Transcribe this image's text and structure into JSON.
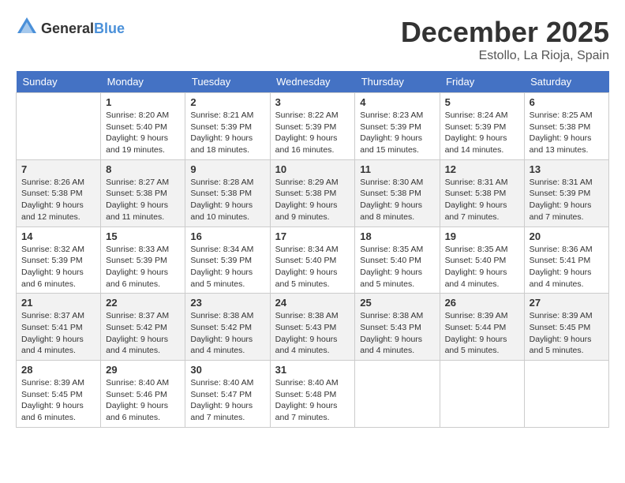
{
  "logo": {
    "general": "General",
    "blue": "Blue"
  },
  "title": "December 2025",
  "location": "Estollo, La Rioja, Spain",
  "weekdays": [
    "Sunday",
    "Monday",
    "Tuesday",
    "Wednesday",
    "Thursday",
    "Friday",
    "Saturday"
  ],
  "weeks": [
    [
      {
        "day": "",
        "sunrise": "",
        "sunset": "",
        "daylight": ""
      },
      {
        "day": "1",
        "sunrise": "Sunrise: 8:20 AM",
        "sunset": "Sunset: 5:40 PM",
        "daylight": "Daylight: 9 hours and 19 minutes."
      },
      {
        "day": "2",
        "sunrise": "Sunrise: 8:21 AM",
        "sunset": "Sunset: 5:39 PM",
        "daylight": "Daylight: 9 hours and 18 minutes."
      },
      {
        "day": "3",
        "sunrise": "Sunrise: 8:22 AM",
        "sunset": "Sunset: 5:39 PM",
        "daylight": "Daylight: 9 hours and 16 minutes."
      },
      {
        "day": "4",
        "sunrise": "Sunrise: 8:23 AM",
        "sunset": "Sunset: 5:39 PM",
        "daylight": "Daylight: 9 hours and 15 minutes."
      },
      {
        "day": "5",
        "sunrise": "Sunrise: 8:24 AM",
        "sunset": "Sunset: 5:39 PM",
        "daylight": "Daylight: 9 hours and 14 minutes."
      },
      {
        "day": "6",
        "sunrise": "Sunrise: 8:25 AM",
        "sunset": "Sunset: 5:38 PM",
        "daylight": "Daylight: 9 hours and 13 minutes."
      }
    ],
    [
      {
        "day": "7",
        "sunrise": "Sunrise: 8:26 AM",
        "sunset": "Sunset: 5:38 PM",
        "daylight": "Daylight: 9 hours and 12 minutes."
      },
      {
        "day": "8",
        "sunrise": "Sunrise: 8:27 AM",
        "sunset": "Sunset: 5:38 PM",
        "daylight": "Daylight: 9 hours and 11 minutes."
      },
      {
        "day": "9",
        "sunrise": "Sunrise: 8:28 AM",
        "sunset": "Sunset: 5:38 PM",
        "daylight": "Daylight: 9 hours and 10 minutes."
      },
      {
        "day": "10",
        "sunrise": "Sunrise: 8:29 AM",
        "sunset": "Sunset: 5:38 PM",
        "daylight": "Daylight: 9 hours and 9 minutes."
      },
      {
        "day": "11",
        "sunrise": "Sunrise: 8:30 AM",
        "sunset": "Sunset: 5:38 PM",
        "daylight": "Daylight: 9 hours and 8 minutes."
      },
      {
        "day": "12",
        "sunrise": "Sunrise: 8:31 AM",
        "sunset": "Sunset: 5:38 PM",
        "daylight": "Daylight: 9 hours and 7 minutes."
      },
      {
        "day": "13",
        "sunrise": "Sunrise: 8:31 AM",
        "sunset": "Sunset: 5:39 PM",
        "daylight": "Daylight: 9 hours and 7 minutes."
      }
    ],
    [
      {
        "day": "14",
        "sunrise": "Sunrise: 8:32 AM",
        "sunset": "Sunset: 5:39 PM",
        "daylight": "Daylight: 9 hours and 6 minutes."
      },
      {
        "day": "15",
        "sunrise": "Sunrise: 8:33 AM",
        "sunset": "Sunset: 5:39 PM",
        "daylight": "Daylight: 9 hours and 6 minutes."
      },
      {
        "day": "16",
        "sunrise": "Sunrise: 8:34 AM",
        "sunset": "Sunset: 5:39 PM",
        "daylight": "Daylight: 9 hours and 5 minutes."
      },
      {
        "day": "17",
        "sunrise": "Sunrise: 8:34 AM",
        "sunset": "Sunset: 5:40 PM",
        "daylight": "Daylight: 9 hours and 5 minutes."
      },
      {
        "day": "18",
        "sunrise": "Sunrise: 8:35 AM",
        "sunset": "Sunset: 5:40 PM",
        "daylight": "Daylight: 9 hours and 5 minutes."
      },
      {
        "day": "19",
        "sunrise": "Sunrise: 8:35 AM",
        "sunset": "Sunset: 5:40 PM",
        "daylight": "Daylight: 9 hours and 4 minutes."
      },
      {
        "day": "20",
        "sunrise": "Sunrise: 8:36 AM",
        "sunset": "Sunset: 5:41 PM",
        "daylight": "Daylight: 9 hours and 4 minutes."
      }
    ],
    [
      {
        "day": "21",
        "sunrise": "Sunrise: 8:37 AM",
        "sunset": "Sunset: 5:41 PM",
        "daylight": "Daylight: 9 hours and 4 minutes."
      },
      {
        "day": "22",
        "sunrise": "Sunrise: 8:37 AM",
        "sunset": "Sunset: 5:42 PM",
        "daylight": "Daylight: 9 hours and 4 minutes."
      },
      {
        "day": "23",
        "sunrise": "Sunrise: 8:38 AM",
        "sunset": "Sunset: 5:42 PM",
        "daylight": "Daylight: 9 hours and 4 minutes."
      },
      {
        "day": "24",
        "sunrise": "Sunrise: 8:38 AM",
        "sunset": "Sunset: 5:43 PM",
        "daylight": "Daylight: 9 hours and 4 minutes."
      },
      {
        "day": "25",
        "sunrise": "Sunrise: 8:38 AM",
        "sunset": "Sunset: 5:43 PM",
        "daylight": "Daylight: 9 hours and 4 minutes."
      },
      {
        "day": "26",
        "sunrise": "Sunrise: 8:39 AM",
        "sunset": "Sunset: 5:44 PM",
        "daylight": "Daylight: 9 hours and 5 minutes."
      },
      {
        "day": "27",
        "sunrise": "Sunrise: 8:39 AM",
        "sunset": "Sunset: 5:45 PM",
        "daylight": "Daylight: 9 hours and 5 minutes."
      }
    ],
    [
      {
        "day": "28",
        "sunrise": "Sunrise: 8:39 AM",
        "sunset": "Sunset: 5:45 PM",
        "daylight": "Daylight: 9 hours and 6 minutes."
      },
      {
        "day": "29",
        "sunrise": "Sunrise: 8:40 AM",
        "sunset": "Sunset: 5:46 PM",
        "daylight": "Daylight: 9 hours and 6 minutes."
      },
      {
        "day": "30",
        "sunrise": "Sunrise: 8:40 AM",
        "sunset": "Sunset: 5:47 PM",
        "daylight": "Daylight: 9 hours and 7 minutes."
      },
      {
        "day": "31",
        "sunrise": "Sunrise: 8:40 AM",
        "sunset": "Sunset: 5:48 PM",
        "daylight": "Daylight: 9 hours and 7 minutes."
      },
      {
        "day": "",
        "sunrise": "",
        "sunset": "",
        "daylight": ""
      },
      {
        "day": "",
        "sunrise": "",
        "sunset": "",
        "daylight": ""
      },
      {
        "day": "",
        "sunrise": "",
        "sunset": "",
        "daylight": ""
      }
    ]
  ]
}
